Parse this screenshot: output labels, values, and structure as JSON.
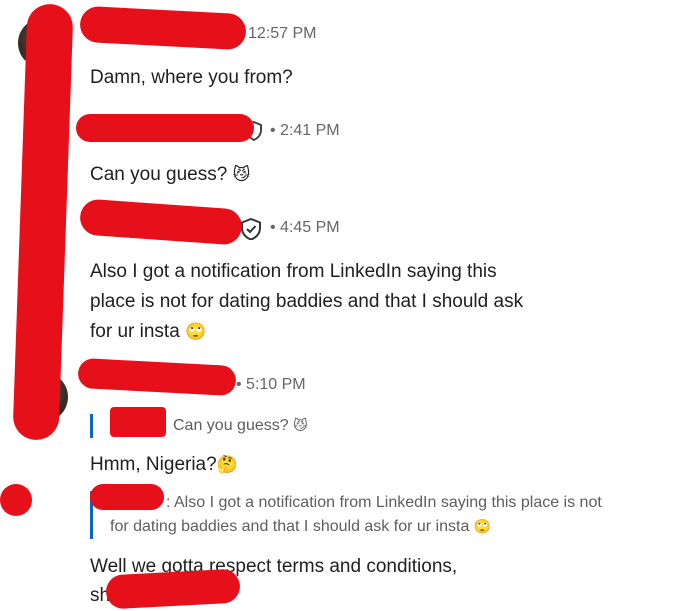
{
  "messages": [
    {
      "time": "12:57 PM",
      "text": "Damn, where you from?"
    },
    {
      "time": "• 2:41 PM",
      "text": "Can you guess?",
      "emoji": "😼"
    },
    {
      "time": "• 4:45 PM",
      "lines": [
        "Also I got a notification from LinkedIn saying this",
        "place is not for dating baddies and that I should ask",
        "for ur insta"
      ],
      "emoji": "🙄"
    },
    {
      "time": "• 5:10 PM",
      "quote1": {
        "text": "Can you guess?",
        "emoji": "😼"
      },
      "reply1": {
        "text": "Hmm, Nigeria?",
        "emoji": "🤔"
      },
      "quote2": {
        "lines": [
          ": Also I got a notification from LinkedIn saying this place is not",
          "for dating baddies and that I should ask for ur insta"
        ],
        "emoji": "🙄"
      },
      "reply2": {
        "lines": [
          "Well we gotta respect terms and conditions,",
          "sh"
        ]
      }
    }
  ],
  "colors": {
    "redaction": "#e6101a",
    "quote_bar": "#0a66c2",
    "meta": "#666666"
  }
}
